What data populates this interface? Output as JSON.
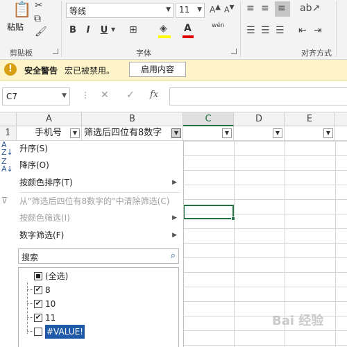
{
  "ribbon": {
    "clipboard": {
      "paste_label": "粘贴",
      "group_label": "剪贴板"
    },
    "font": {
      "font_name": "等线",
      "font_size": "11",
      "group_label": "字体",
      "bold": "B",
      "italic": "I",
      "underline": "U",
      "phonetic": "wén"
    },
    "alignment": {
      "group_label": "对齐方式"
    }
  },
  "security_bar": {
    "title": "安全警告",
    "message": "宏已被禁用。",
    "button": "启用内容"
  },
  "formula_bar": {
    "name_box": "C7",
    "fx": "fx",
    "cancel": "✕",
    "enter": "✓"
  },
  "grid": {
    "columns": [
      "A",
      "B",
      "C",
      "D",
      "E"
    ],
    "row_number": "1",
    "header_cells": [
      "手机号",
      "筛选后四位有8数字"
    ]
  },
  "filter_menu": {
    "sort_asc": "升序(S)",
    "sort_desc": "降序(O)",
    "sort_color": "按颜色排序(T)",
    "clear_filter": "从\"筛选后四位有8数字的\"中清除筛选(C)",
    "filter_color": "按颜色筛选(I)",
    "number_filter": "数字筛选(F)",
    "search_placeholder": "搜索",
    "items": [
      {
        "label": "(全选)",
        "state": "partial"
      },
      {
        "label": "8",
        "state": "checked"
      },
      {
        "label": "10",
        "state": "checked"
      },
      {
        "label": "11",
        "state": "checked"
      },
      {
        "label": "#VALUE!",
        "state": "unchecked"
      }
    ]
  },
  "watermark": "Bai 经验",
  "colors": {
    "excel_green": "#217346",
    "warning_bg": "#fdf5c9",
    "highlight": "#2b5797"
  }
}
